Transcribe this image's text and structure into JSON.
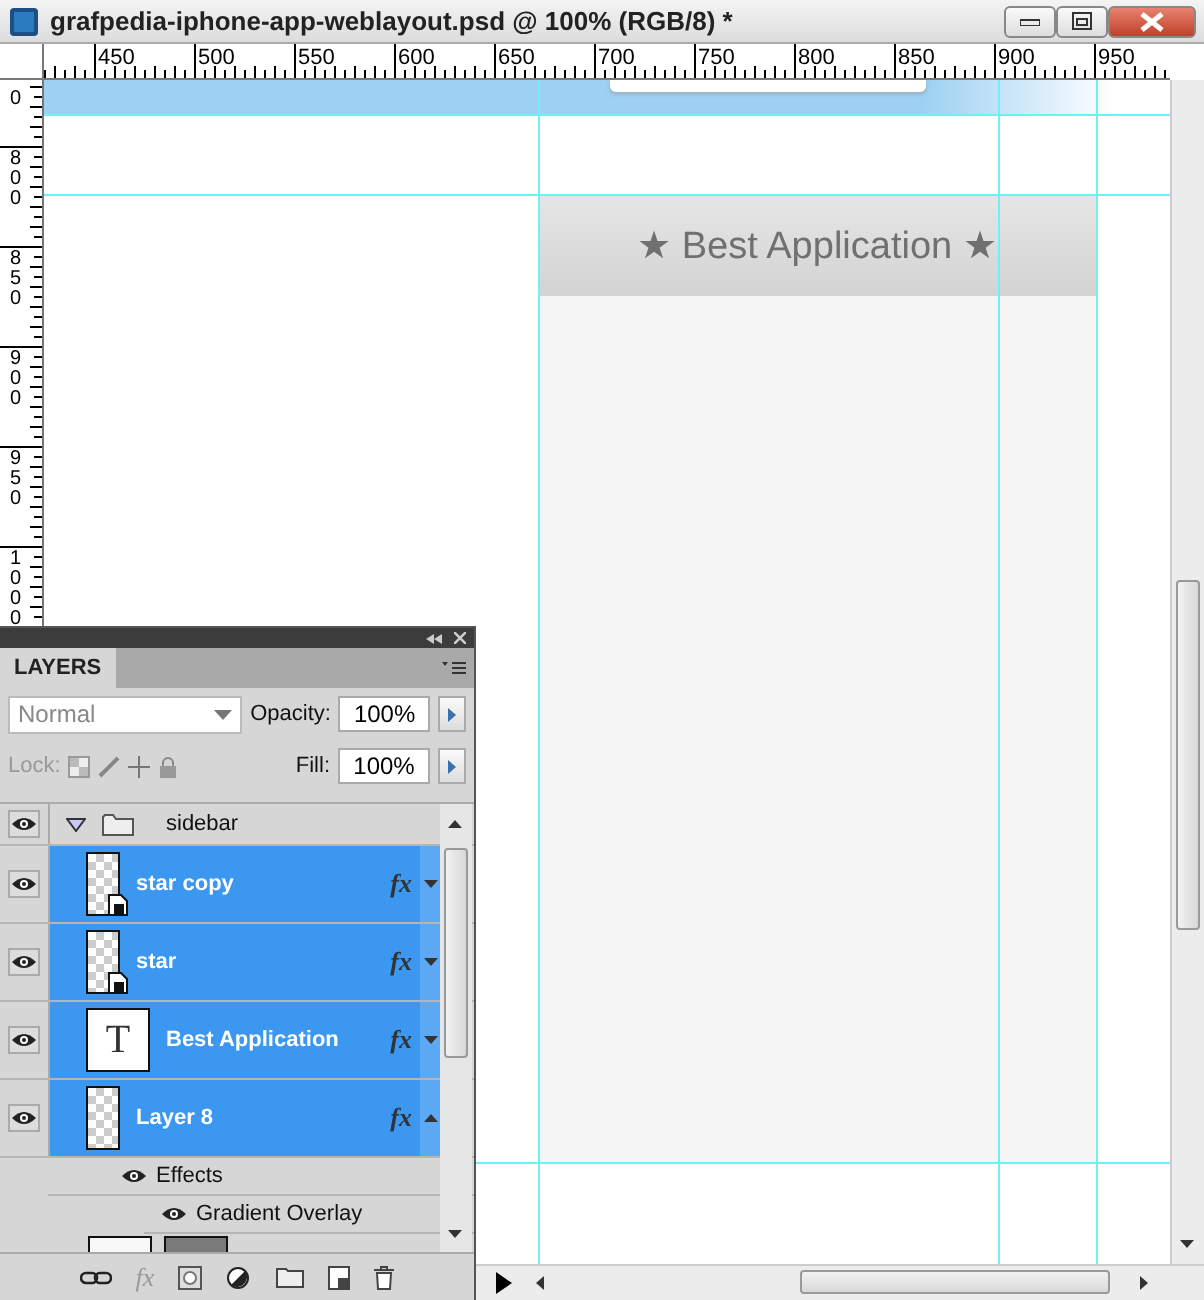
{
  "window": {
    "title": "grafpedia-iphone-app-weblayout.psd @ 100% (RGB/8) *"
  },
  "rulers": {
    "horizontal": [
      "450",
      "500",
      "550",
      "600",
      "650",
      "700",
      "750",
      "800",
      "850",
      "900",
      "950"
    ],
    "vertical": [
      "0",
      "800",
      "850",
      "900",
      "950",
      "1000"
    ]
  },
  "canvas": {
    "card_title": "★ Best Application ★"
  },
  "layers_panel": {
    "tab": "LAYERS",
    "blend_mode": "Normal",
    "opacity_label": "Opacity:",
    "opacity": "100%",
    "lock_label": "Lock:",
    "fill_label": "Fill:",
    "fill": "100%",
    "group": {
      "name": "sidebar",
      "expanded": true,
      "visible": true
    },
    "layers": [
      {
        "name": "star copy",
        "kind": "smart_object",
        "selected": true,
        "visible": true,
        "fx": "fx",
        "effects_expanded": false
      },
      {
        "name": "star",
        "kind": "smart_object",
        "selected": true,
        "visible": true,
        "fx": "fx",
        "effects_expanded": false
      },
      {
        "name": "Best Application",
        "kind": "text",
        "thumbnail_text": "T",
        "selected": true,
        "visible": true,
        "fx": "fx",
        "effects_expanded": false
      },
      {
        "name": "Layer 8",
        "kind": "raster",
        "selected": true,
        "visible": true,
        "fx": "fx",
        "effects_expanded": true,
        "effects_label": "Effects",
        "effects": [
          "Gradient Overlay"
        ]
      }
    ],
    "toolbar_fx": "fx"
  }
}
